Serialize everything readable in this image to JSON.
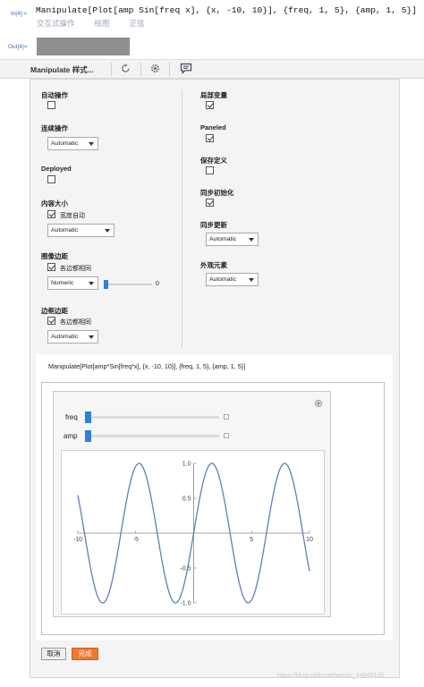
{
  "notebook": {
    "in_label": "In[4]:=",
    "out_label": "Out[4]=",
    "input_code": "Manipulate[Plot[amp Sin[freq x], {x, -10, 10}], {freq, 1, 5}, {amp, 1, 5}]",
    "sub_labels": [
      "交互式操作",
      "绘图",
      "正弦"
    ]
  },
  "toolbar": {
    "title": "Manipulate 样式...",
    "icons": [
      "refresh-icon",
      "gear-icon",
      "comment-icon"
    ]
  },
  "options_left": {
    "auto_action": {
      "label": "自动操作",
      "checked": false
    },
    "continuous_action": {
      "label": "连续操作",
      "value": "Automatic"
    },
    "deployed": {
      "label": "Deployed",
      "checked": false
    },
    "content_size": {
      "label": "内容大小",
      "checkbox_label": "宽度自动",
      "checked": true,
      "value": "Automatic"
    },
    "image_margins": {
      "label": "图像边距",
      "checkbox_label": "各边都相同",
      "checked": true,
      "value": "Numeric",
      "slider_value": "0"
    },
    "frame_margins": {
      "label": "边框边距",
      "checkbox_label": "各边都相同",
      "checked": true,
      "value": "Automatic"
    }
  },
  "options_right": {
    "local_variables": {
      "label": "局部变量",
      "checked": true
    },
    "paneled": {
      "label": "Paneled",
      "checked": true
    },
    "save_definitions": {
      "label": "保存定义",
      "checked": false
    },
    "sync_initialization": {
      "label": "同步初始化",
      "checked": true
    },
    "sync_update": {
      "label": "同步更新",
      "value": "Automatic"
    },
    "appearance_elements": {
      "label": "外观元素",
      "value": "Automatic"
    }
  },
  "preview": {
    "expression": "Manipulate[Plot[amp*Sin[freq*x], {x, -10, 10}], {freq, 1, 5}, {amp, 1, 5}]",
    "controls": [
      {
        "label": "freq",
        "value": 1,
        "min": 1,
        "max": 5
      },
      {
        "label": "amp",
        "value": 1,
        "min": 1,
        "max": 5
      }
    ]
  },
  "chart_data": {
    "type": "line",
    "function": "1*Sin[1*x]",
    "x_range": [
      -10,
      10
    ],
    "y_range": [
      -1.0,
      1.0
    ],
    "x_ticks": [
      -10,
      -5,
      5,
      10
    ],
    "y_ticks": [
      1.0,
      0.5,
      -0.5,
      -1.0
    ],
    "x_tick_labels": [
      "-10",
      "-5",
      "5",
      "10"
    ],
    "y_tick_labels": [
      "1.0",
      "0.5",
      "-0.5",
      "-1.0"
    ],
    "line_color": "#5e81b5",
    "grid": false
  },
  "buttons": {
    "cancel": "取消",
    "done": "完成"
  },
  "watermark": "https://blog.csdn.net/weixin_44945135"
}
